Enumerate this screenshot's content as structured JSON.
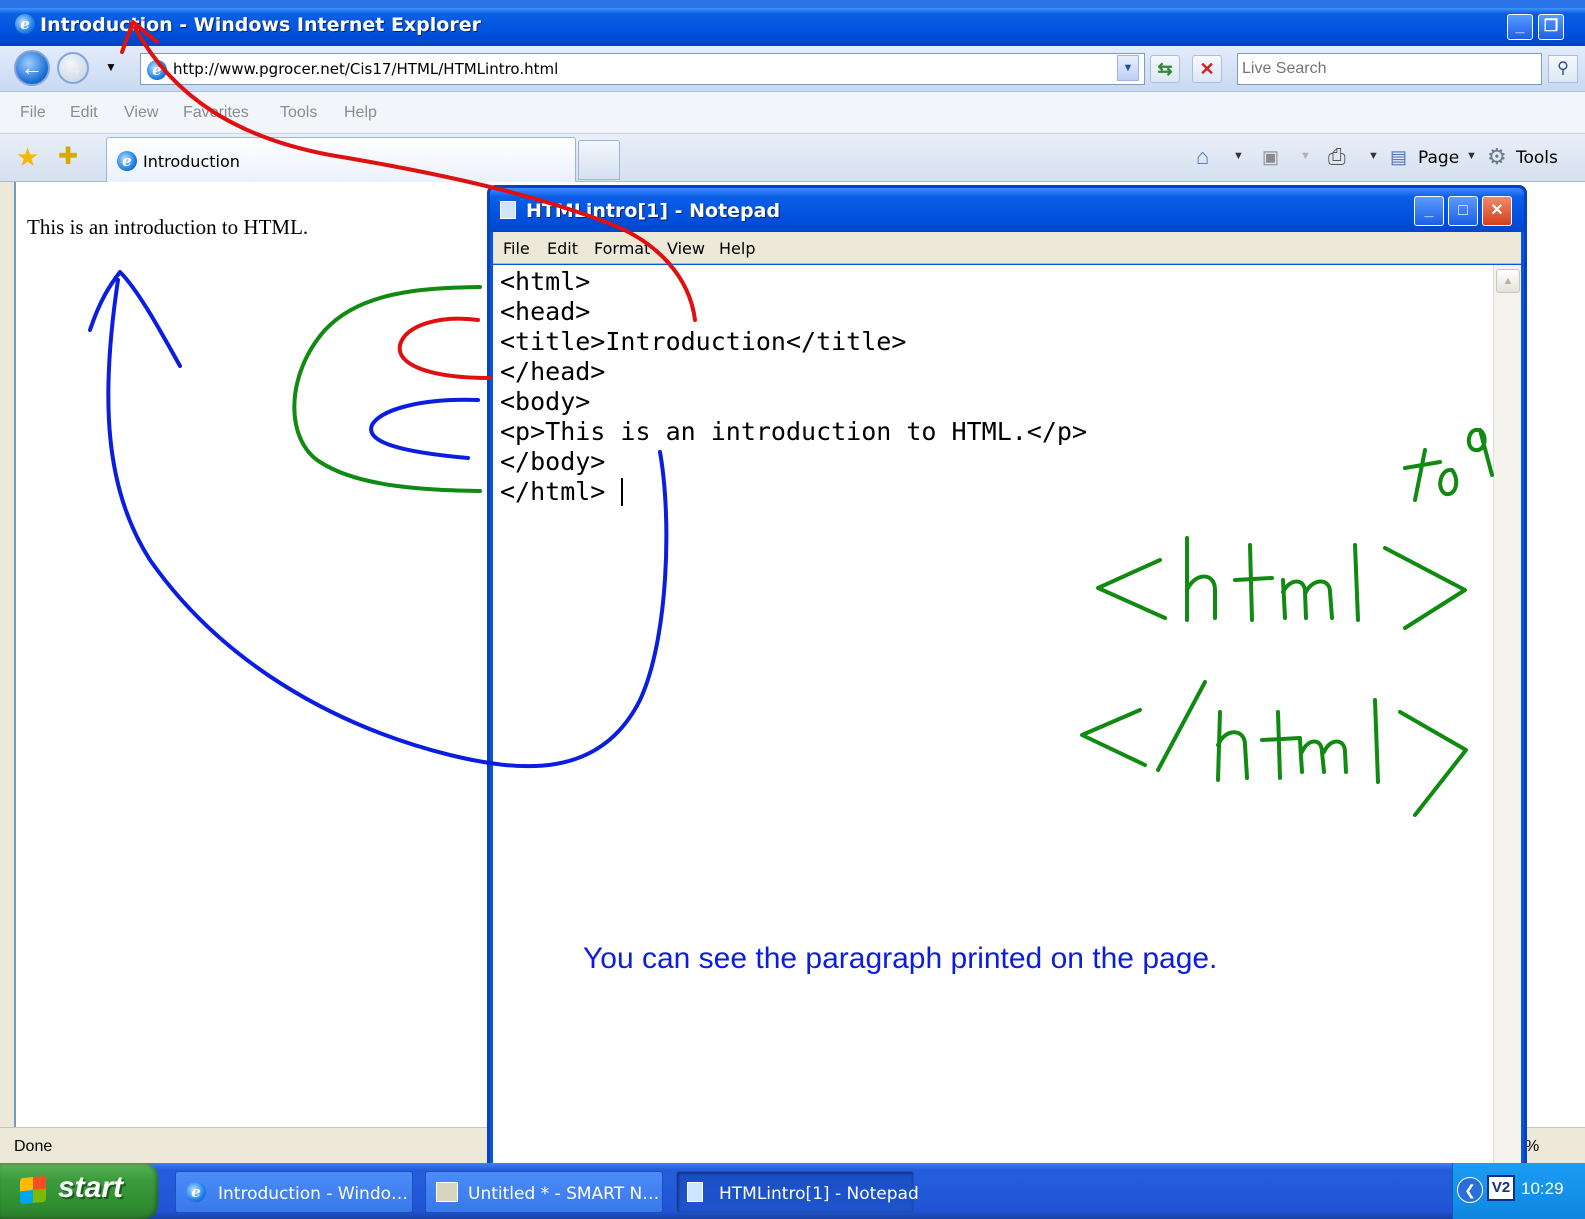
{
  "ie": {
    "title": "Introduction - Windows Internet Explorer",
    "url": "http://www.pgrocer.net/Cis17/HTML/HTMLintro.html",
    "search_placeholder": "Live Search",
    "menu": [
      "File",
      "Edit",
      "View",
      "Favorites",
      "Tools",
      "Help"
    ],
    "tab_label": "Introduction",
    "commands": {
      "page": "Page",
      "tools": "Tools"
    },
    "page_text": "This is an introduction to HTML.",
    "status_text": "Done",
    "zoom_text": "%"
  },
  "notepad": {
    "title": "HTMLintro[1] - Notepad",
    "menu": [
      "File",
      "Edit",
      "Format",
      "View",
      "Help"
    ],
    "code_lines": [
      "<html>",
      "<head>",
      "<title>Introduction</title>",
      "</head>",
      "<body>",
      "<p>This is an introduction to HTML.</p>",
      "</body>",
      "</html>"
    ]
  },
  "annotations": {
    "caption": "You can see the paragraph printed on the page.",
    "handwriting": [
      "tag",
      "<html>",
      "</html>"
    ],
    "colors": {
      "blue": "#0b1ee0",
      "green": "#108a10",
      "red": "#e01010"
    }
  },
  "taskbar": {
    "start_label": "start",
    "tasks": [
      {
        "label": "Introduction - Windo…",
        "icon": "ie-icon",
        "active": false
      },
      {
        "label": "Untitled * - SMART N…",
        "icon": "smart-notebook-icon",
        "active": false
      },
      {
        "label": "HTMLintro[1] - Notepad",
        "icon": "notepad-icon",
        "active": true
      }
    ],
    "tray_badge": "V2",
    "clock": "10:29"
  }
}
